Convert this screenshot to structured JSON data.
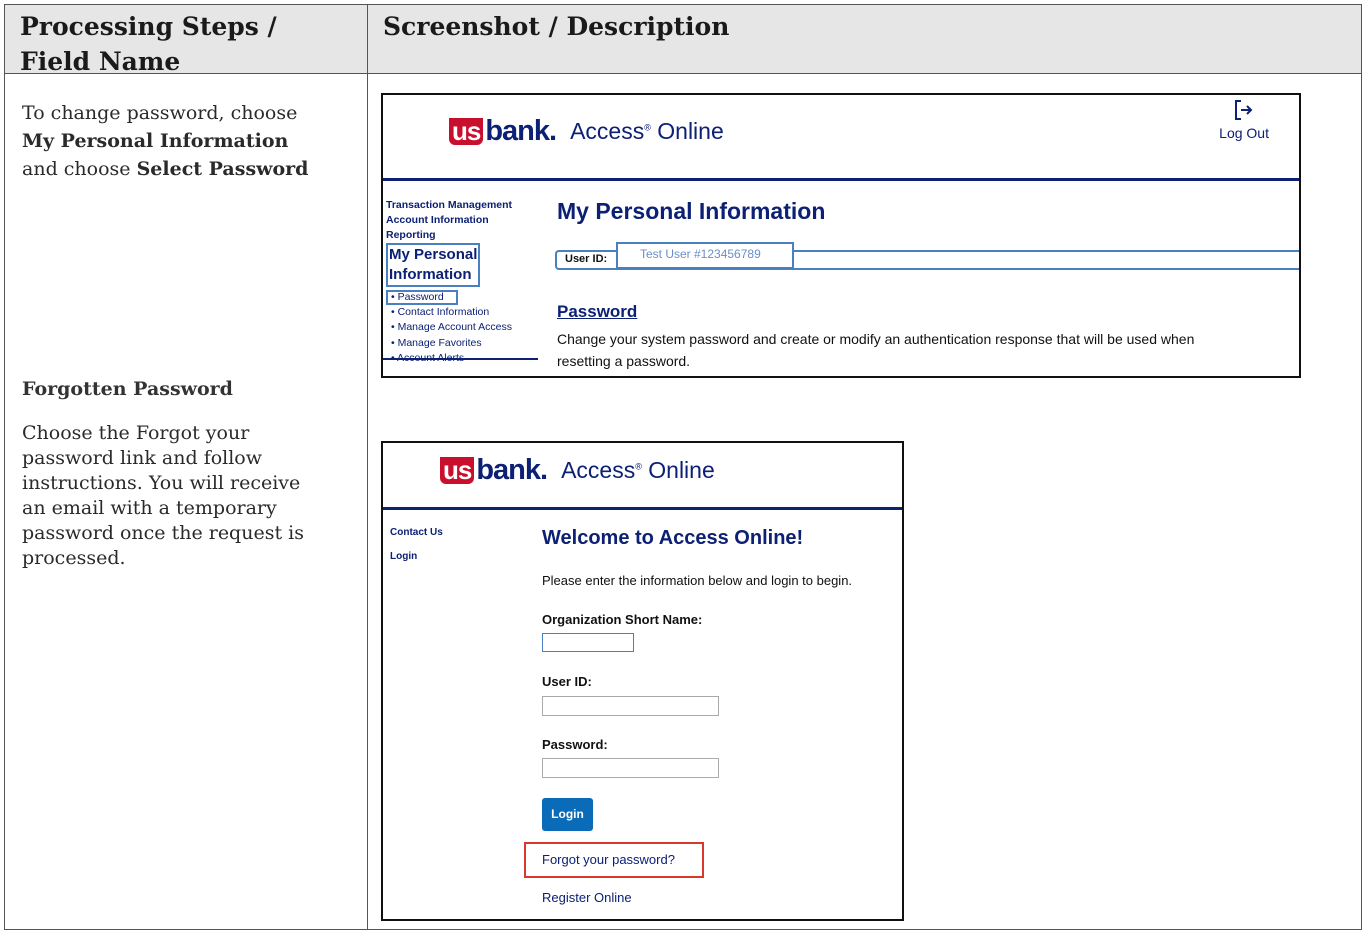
{
  "header": {
    "col1_line1": "Processing Steps /",
    "col1_line2": "Field Name",
    "col2": "Screenshot / Description"
  },
  "left": {
    "intro_prefix": "To change password, choose",
    "intro_bold1": "My Personal Information",
    "intro_mid": "and choose",
    "intro_bold2": "Select Password",
    "forgot_heading": "Forgotten Password",
    "forgot_line1": "Choose the Forgot your",
    "forgot_line2": "password link and follow",
    "forgot_line3": "instructions. You will receive",
    "forgot_line4": "an email with a temporary",
    "forgot_line5": "password once the request is",
    "forgot_line6": "processed."
  },
  "shot1": {
    "logo_us": "us",
    "logo_bank": "bank",
    "logo_dot": ".",
    "logo_product": "Access",
    "logo_reg": "®",
    "logo_product2": " Online",
    "logout_label": "Log Out",
    "nav": {
      "transaction": "Transaction Management",
      "account_info": "Account Information",
      "reporting": "Reporting",
      "personal_line1": "My Personal",
      "personal_line2": "Information",
      "sub_items": [
        "• Password",
        "• Contact Information",
        "• Manage Account Access",
        "• Manage Favorites",
        "• Account Alerts"
      ]
    },
    "page_title": "My Personal Information",
    "userid_label": "User ID:",
    "userid_value": "Test User #123456789",
    "password_link": "Password",
    "password_desc_line1": "Change your system password and create or modify an authentication response that will be used when",
    "password_desc_line2": "resetting a password."
  },
  "shot2": {
    "nav_contact": "Contact Us",
    "nav_login": "Login",
    "welcome": "Welcome to Access Online!",
    "instructions": "Please enter the information below and login to begin.",
    "org_label": "Organization Short Name:",
    "org_value": "",
    "userid_label": "User ID:",
    "userid_value": "",
    "password_label": "Password:",
    "password_value": "",
    "login_button": "Login",
    "forgot_link": "Forgot your password?",
    "register_link": "Register Online"
  },
  "colors": {
    "brand_navy": "#0c2074",
    "brand_red": "#c8102e",
    "highlight_blue": "#4a7fc1",
    "highlight_red": "#d9392b",
    "button_blue": "#0a6cb8"
  }
}
